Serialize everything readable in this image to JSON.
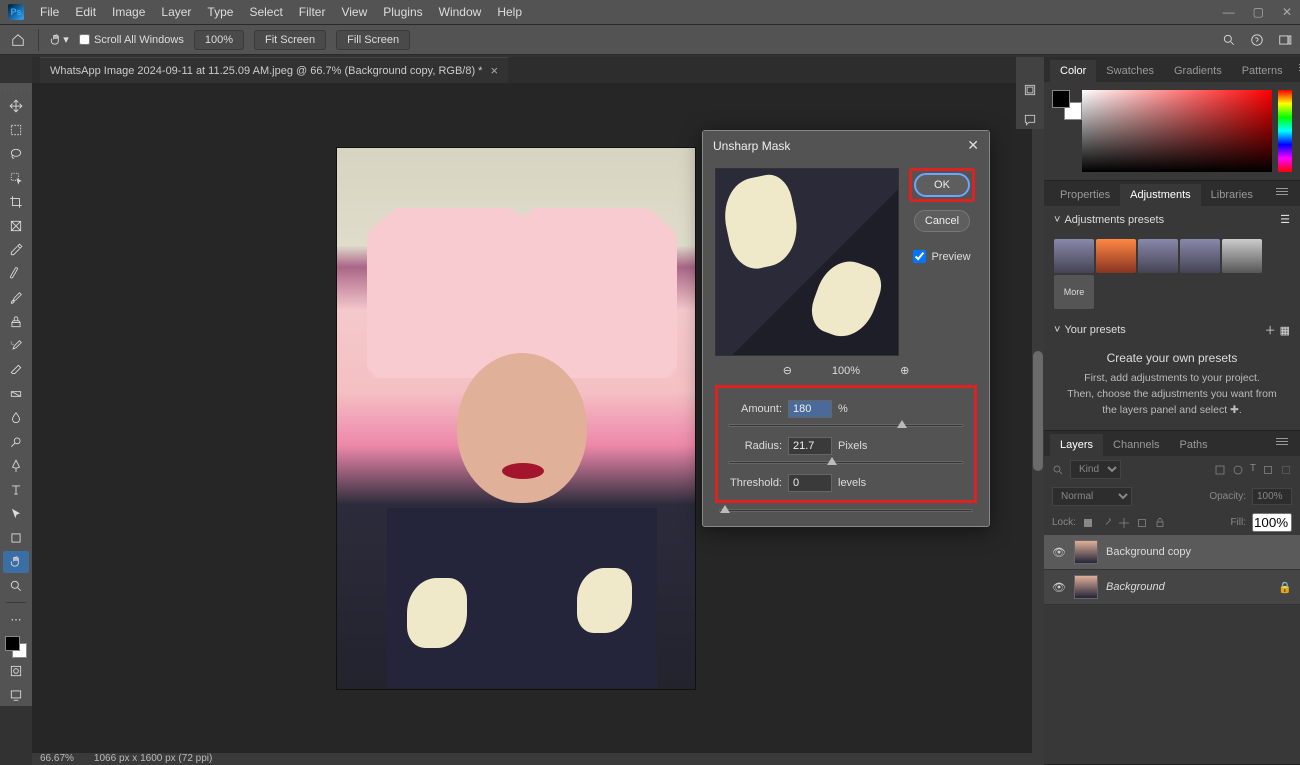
{
  "menu": {
    "items": [
      "File",
      "Edit",
      "Image",
      "Layer",
      "Type",
      "Select",
      "Filter",
      "View",
      "Plugins",
      "Window",
      "Help"
    ]
  },
  "optbar": {
    "scroll_all": "Scroll All Windows",
    "zoom": "100%",
    "fit_screen": "Fit Screen",
    "fill_screen": "Fill Screen"
  },
  "doc_tab": "WhatsApp Image 2024-09-11 at 11.25.09 AM.jpeg @ 66.7% (Background copy, RGB/8) *",
  "statusbar": {
    "zoom": "66.67%",
    "dims": "1066 px x 1600 px (72 ppi)"
  },
  "color_panel": {
    "tabs": [
      "Color",
      "Swatches",
      "Gradients",
      "Patterns"
    ]
  },
  "adjust_panel": {
    "tabs": [
      "Properties",
      "Adjustments",
      "Libraries"
    ],
    "presets_head": "Adjustments presets",
    "more": "More",
    "your_presets": "Your presets",
    "help_title": "Create your own presets",
    "help_l1": "First, add adjustments to your project.",
    "help_l2": "Then, choose the adjustments you want from the layers panel and select ✚."
  },
  "layers_panel": {
    "tabs": [
      "Layers",
      "Channels",
      "Paths"
    ],
    "kind": "Kind",
    "blend": "Normal",
    "opacity_label": "Opacity:",
    "opacity": "100%",
    "lock_label": "Lock:",
    "fill_label": "Fill:",
    "fill": "100%",
    "rows": [
      {
        "name": "Background copy",
        "locked": false
      },
      {
        "name": "Background",
        "locked": true
      }
    ]
  },
  "dialog": {
    "title": "Unsharp Mask",
    "ok": "OK",
    "cancel": "Cancel",
    "preview": "Preview",
    "zoom": "100%",
    "amount_label": "Amount:",
    "amount": "180",
    "amount_unit": "%",
    "radius_label": "Radius:",
    "radius": "21.7",
    "radius_unit": "Pixels",
    "threshold_label": "Threshold:",
    "threshold": "0",
    "threshold_unit": "levels"
  }
}
